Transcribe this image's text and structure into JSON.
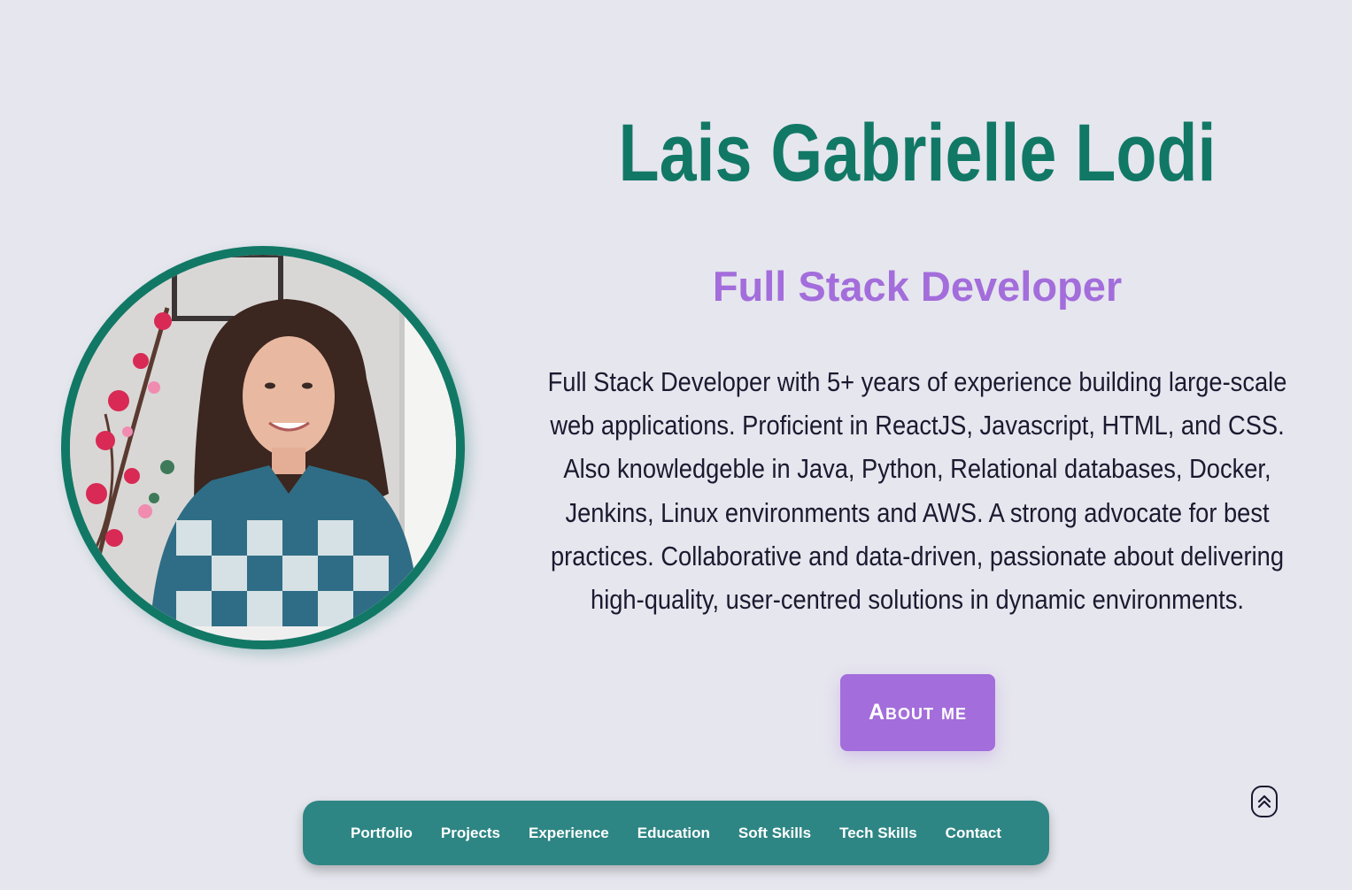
{
  "hero": {
    "name": "Lais Gabrielle Lodi",
    "role": "Full Stack Developer",
    "bio": "Full Stack Developer with 5+ years of experience building large-scale web applications. Proficient in ReactJS, Javascript, HTML, and CSS. Also knowledgeble in Java, Python, Relational databases, Docker, Jenkins, Linux environments and AWS. A strong advocate for best practices. Collaborative and data-driven, passionate about delivering high-quality, user-centred solutions in dynamic environments.",
    "about_button": "About me",
    "avatar_icon": "profile-photo"
  },
  "nav": {
    "items": [
      {
        "label": "Portfolio"
      },
      {
        "label": "Projects"
      },
      {
        "label": "Experience"
      },
      {
        "label": "Education"
      },
      {
        "label": "Soft Skills"
      },
      {
        "label": "Tech Skills"
      },
      {
        "label": "Contact"
      }
    ]
  },
  "scroll_top": {
    "icon": "double-chevron-up-icon"
  },
  "colors": {
    "background": "#e6e6ee",
    "primary": "#127866",
    "accent": "#a36ddb",
    "nav": "#2e8684",
    "text": "#1a1a30"
  }
}
